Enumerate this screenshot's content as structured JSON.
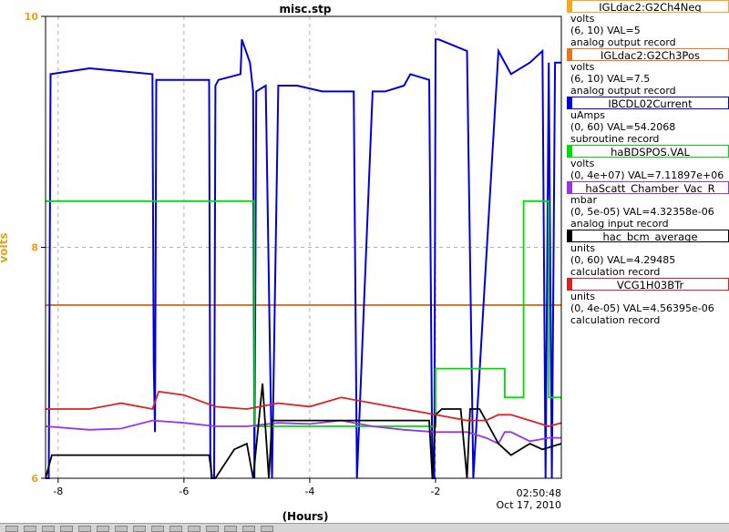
{
  "chart_data": {
    "type": "line",
    "title": "misc.stp",
    "xlabel": "(Hours)",
    "ylabel": "volts",
    "xlim": [
      -8.2,
      0.0
    ],
    "ylim": [
      6,
      10
    ],
    "x_ticks": [
      "-8",
      "-6",
      "-4",
      "-2"
    ],
    "y_ticks": [
      "6",
      "8",
      "10"
    ],
    "timestamp": "02:50:48",
    "date": "Oct 17, 2010",
    "grid": true,
    "series": [
      {
        "name": "IGLdac2:G2Ch4Neg",
        "color": "#f5a623",
        "x": [
          -8.2,
          0.0
        ],
        "y": [
          7.5,
          7.5
        ]
      },
      {
        "name": "IGLdac2:G2Ch3Pos",
        "color": "#d2691e",
        "x": [
          -8.2,
          0.0
        ],
        "y": [
          7.5,
          7.5
        ]
      },
      {
        "name": "IBCDL02Current",
        "color": "#0000dd",
        "x": [
          -8.2,
          -8.15,
          -8.12,
          -7.5,
          -6.5,
          -6.48,
          -6.46,
          -6.44,
          -5.6,
          -5.58,
          -5.56,
          -5.52,
          -5.5,
          -5.45,
          -5.1,
          -5.08,
          -4.95,
          -4.9,
          -4.88,
          -4.85,
          -4.7,
          -4.6,
          -4.5,
          -4.2,
          -3.8,
          -3.3,
          -3.25,
          -3.0,
          -2.8,
          -2.5,
          -2.4,
          -2.1,
          -2.05,
          -2.02,
          -2.0,
          -1.95,
          -1.5,
          -1.4,
          -1.0,
          -0.8,
          -0.5,
          -0.3,
          -0.25,
          -0.2,
          -0.15,
          -0.1,
          0.0
        ],
        "y": [
          6.0,
          6.0,
          9.5,
          9.55,
          9.5,
          7.0,
          6.4,
          9.45,
          9.45,
          6.2,
          6.0,
          6.0,
          9.4,
          9.45,
          9.5,
          9.8,
          9.6,
          9.35,
          6.0,
          9.35,
          9.4,
          6.0,
          9.4,
          9.4,
          9.35,
          9.35,
          6.0,
          9.35,
          9.35,
          9.4,
          9.5,
          9.45,
          6.0,
          6.0,
          9.8,
          9.8,
          9.7,
          6.0,
          9.7,
          9.5,
          9.6,
          9.7,
          6.0,
          9.6,
          6.0,
          9.6,
          9.6
        ]
      },
      {
        "name": "haBDSPOS.VAL",
        "color": "#00dd00",
        "x": [
          -8.2,
          -4.88,
          -4.88,
          -2.0,
          -2.0,
          -1.0,
          -0.9,
          -0.9,
          -0.7,
          -0.6,
          -0.6,
          -0.4,
          -0.2,
          -0.2,
          0.0
        ],
        "y": [
          8.4,
          8.4,
          6.45,
          6.45,
          6.95,
          6.95,
          6.95,
          6.7,
          6.7,
          6.7,
          8.4,
          8.4,
          8.4,
          6.7,
          6.7
        ]
      },
      {
        "name": "haScatt_Chamber_Vac_R",
        "color": "#9933ee",
        "x": [
          -8.2,
          -7.5,
          -7.0,
          -6.5,
          -6.0,
          -5.5,
          -5.0,
          -4.5,
          -4.0,
          -3.5,
          -3.0,
          -2.5,
          -2.0,
          -1.5,
          -1.2,
          -1.0,
          -0.9,
          -0.8,
          -0.5,
          -0.2,
          0.0
        ],
        "y": [
          6.45,
          6.42,
          6.43,
          6.5,
          6.48,
          6.45,
          6.45,
          6.48,
          6.47,
          6.5,
          6.45,
          6.42,
          6.4,
          6.4,
          6.35,
          6.3,
          6.4,
          6.4,
          6.32,
          6.35,
          6.35
        ]
      },
      {
        "name": "hac_bcm_average",
        "color": "#000000",
        "x": [
          -8.2,
          -8.1,
          -8.05,
          -5.6,
          -5.55,
          -5.5,
          -5.2,
          -5.0,
          -4.9,
          -4.75,
          -4.65,
          -4.6,
          -4.5,
          -2.1,
          -2.05,
          -2.0,
          -1.9,
          -1.8,
          -1.6,
          -1.5,
          -1.45,
          -1.3,
          -1.0,
          -0.8,
          -0.5,
          -0.3,
          0.0
        ],
        "y": [
          6.0,
          6.2,
          6.2,
          6.2,
          6.0,
          6.0,
          6.25,
          6.3,
          6.0,
          6.82,
          6.0,
          6.5,
          6.5,
          6.5,
          6.0,
          6.55,
          6.6,
          6.6,
          6.6,
          6.0,
          6.6,
          6.6,
          6.3,
          6.2,
          6.3,
          6.25,
          6.3
        ]
      },
      {
        "name": "VCG1H03BTr",
        "color": "#dd2222",
        "x": [
          -8.2,
          -7.5,
          -7.0,
          -6.5,
          -6.4,
          -6.0,
          -5.5,
          -5.0,
          -4.5,
          -4.0,
          -3.5,
          -3.0,
          -2.5,
          -2.0,
          -1.5,
          -1.2,
          -1.0,
          -0.8,
          -0.5,
          -0.2,
          0.0
        ],
        "y": [
          6.6,
          6.6,
          6.65,
          6.6,
          6.75,
          6.72,
          6.62,
          6.6,
          6.65,
          6.62,
          6.7,
          6.65,
          6.6,
          6.55,
          6.5,
          6.5,
          6.55,
          6.55,
          6.5,
          6.45,
          6.48
        ]
      }
    ]
  },
  "legend": [
    {
      "name": "IGLdac2:G2Ch4Neg",
      "color": "#f5a623",
      "line1": "volts",
      "line2": "(6, 10)  VAL=5",
      "line3": "analog output record"
    },
    {
      "name": "IGLdac2:G2Ch3Pos",
      "color": "#e8741e",
      "line1": "volts",
      "line2": "(6, 10) VAL=7.5",
      "line3": "analog output record"
    },
    {
      "name": "IBCDL02Current",
      "color": "#0000dd",
      "line1": "uAmps",
      "line2": "(0, 60) VAL=54.2068",
      "line3": "subroutine record"
    },
    {
      "name": "haBDSPOS.VAL",
      "color": "#00dd00",
      "line1": "volts",
      "line2": "(0, 4e+07) VAL=7.11897e+06",
      "line3": ""
    },
    {
      "name": "haScatt_Chamber_Vac_R",
      "color": "#9933ee",
      "line1": "mbar",
      "line2": "(0, 5e-05) VAL=4.32358e-06",
      "line3": "analog input record"
    },
    {
      "name": "hac_bcm_average",
      "color": "#000000",
      "line1": "units",
      "line2": "(0, 60) VAL=4.29485",
      "line3": "calculation record"
    },
    {
      "name": "VCG1H03BTr",
      "color": "#dd2222",
      "line1": "units",
      "line2": "(0, 4e-05) VAL=4.56395e-06",
      "line3": "calculation record"
    }
  ]
}
